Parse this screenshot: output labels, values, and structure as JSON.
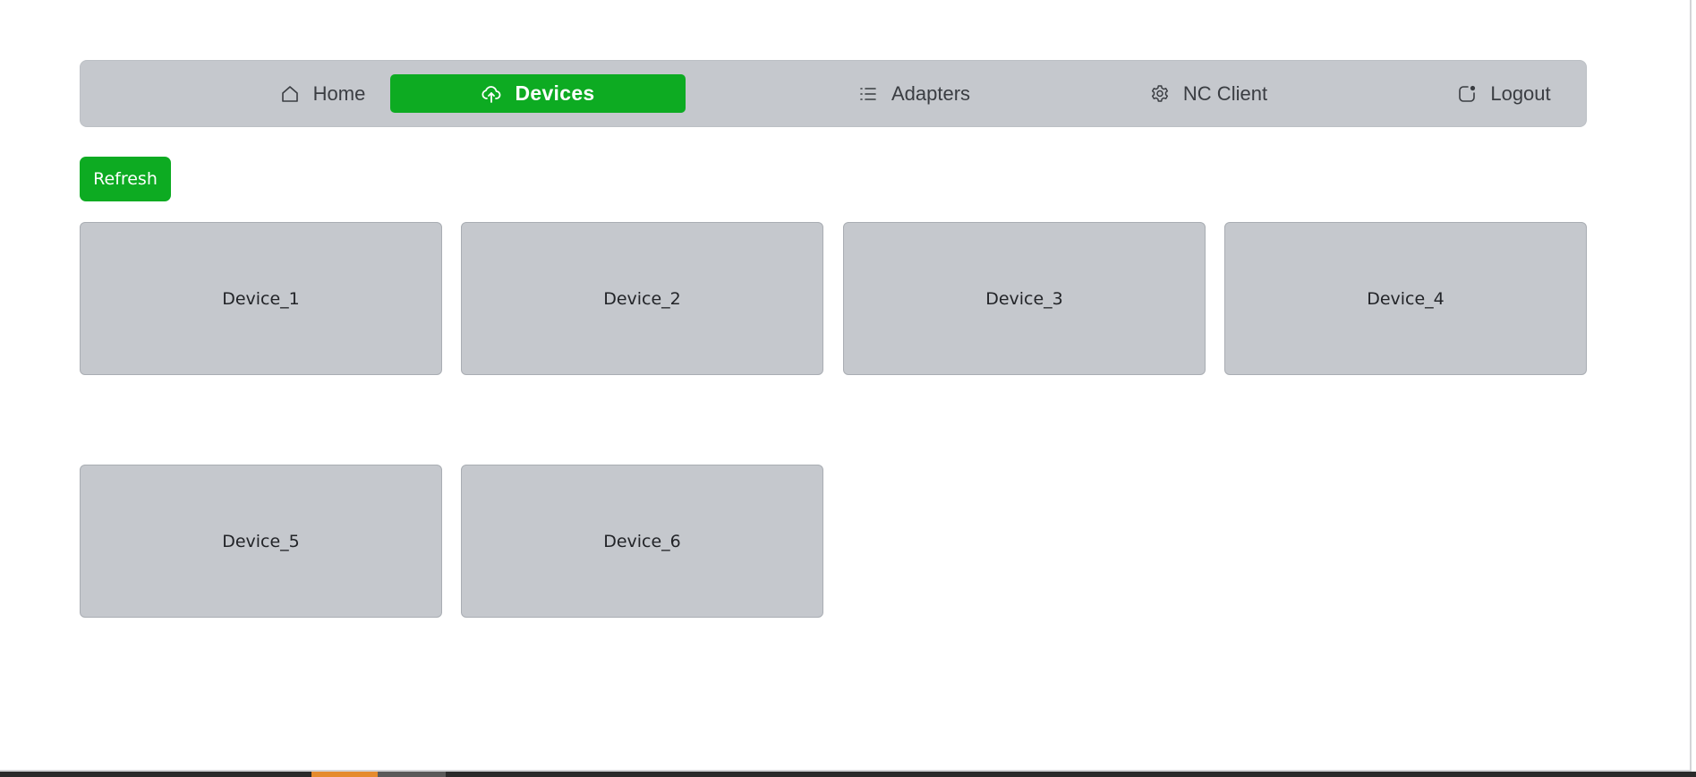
{
  "nav": {
    "items": [
      {
        "label": "Home",
        "icon": "home-icon"
      },
      {
        "label": "Devices",
        "icon": "cloud-upload-icon",
        "active": true
      },
      {
        "label": "Adapters",
        "icon": "list-icon"
      },
      {
        "label": "NC Client",
        "icon": "gear-icon"
      },
      {
        "label": "Logout",
        "icon": "logout-icon"
      }
    ]
  },
  "toolbar": {
    "refresh_label": "Refresh"
  },
  "devices": [
    {
      "name": "Device_1"
    },
    {
      "name": "Device_2"
    },
    {
      "name": "Device_3"
    },
    {
      "name": "Device_4"
    },
    {
      "name": "Device_5"
    },
    {
      "name": "Device_6"
    }
  ],
  "colors": {
    "accent": "#0dab22",
    "nav_background": "#c5c8cd",
    "card_background": "#c5c8cd"
  }
}
